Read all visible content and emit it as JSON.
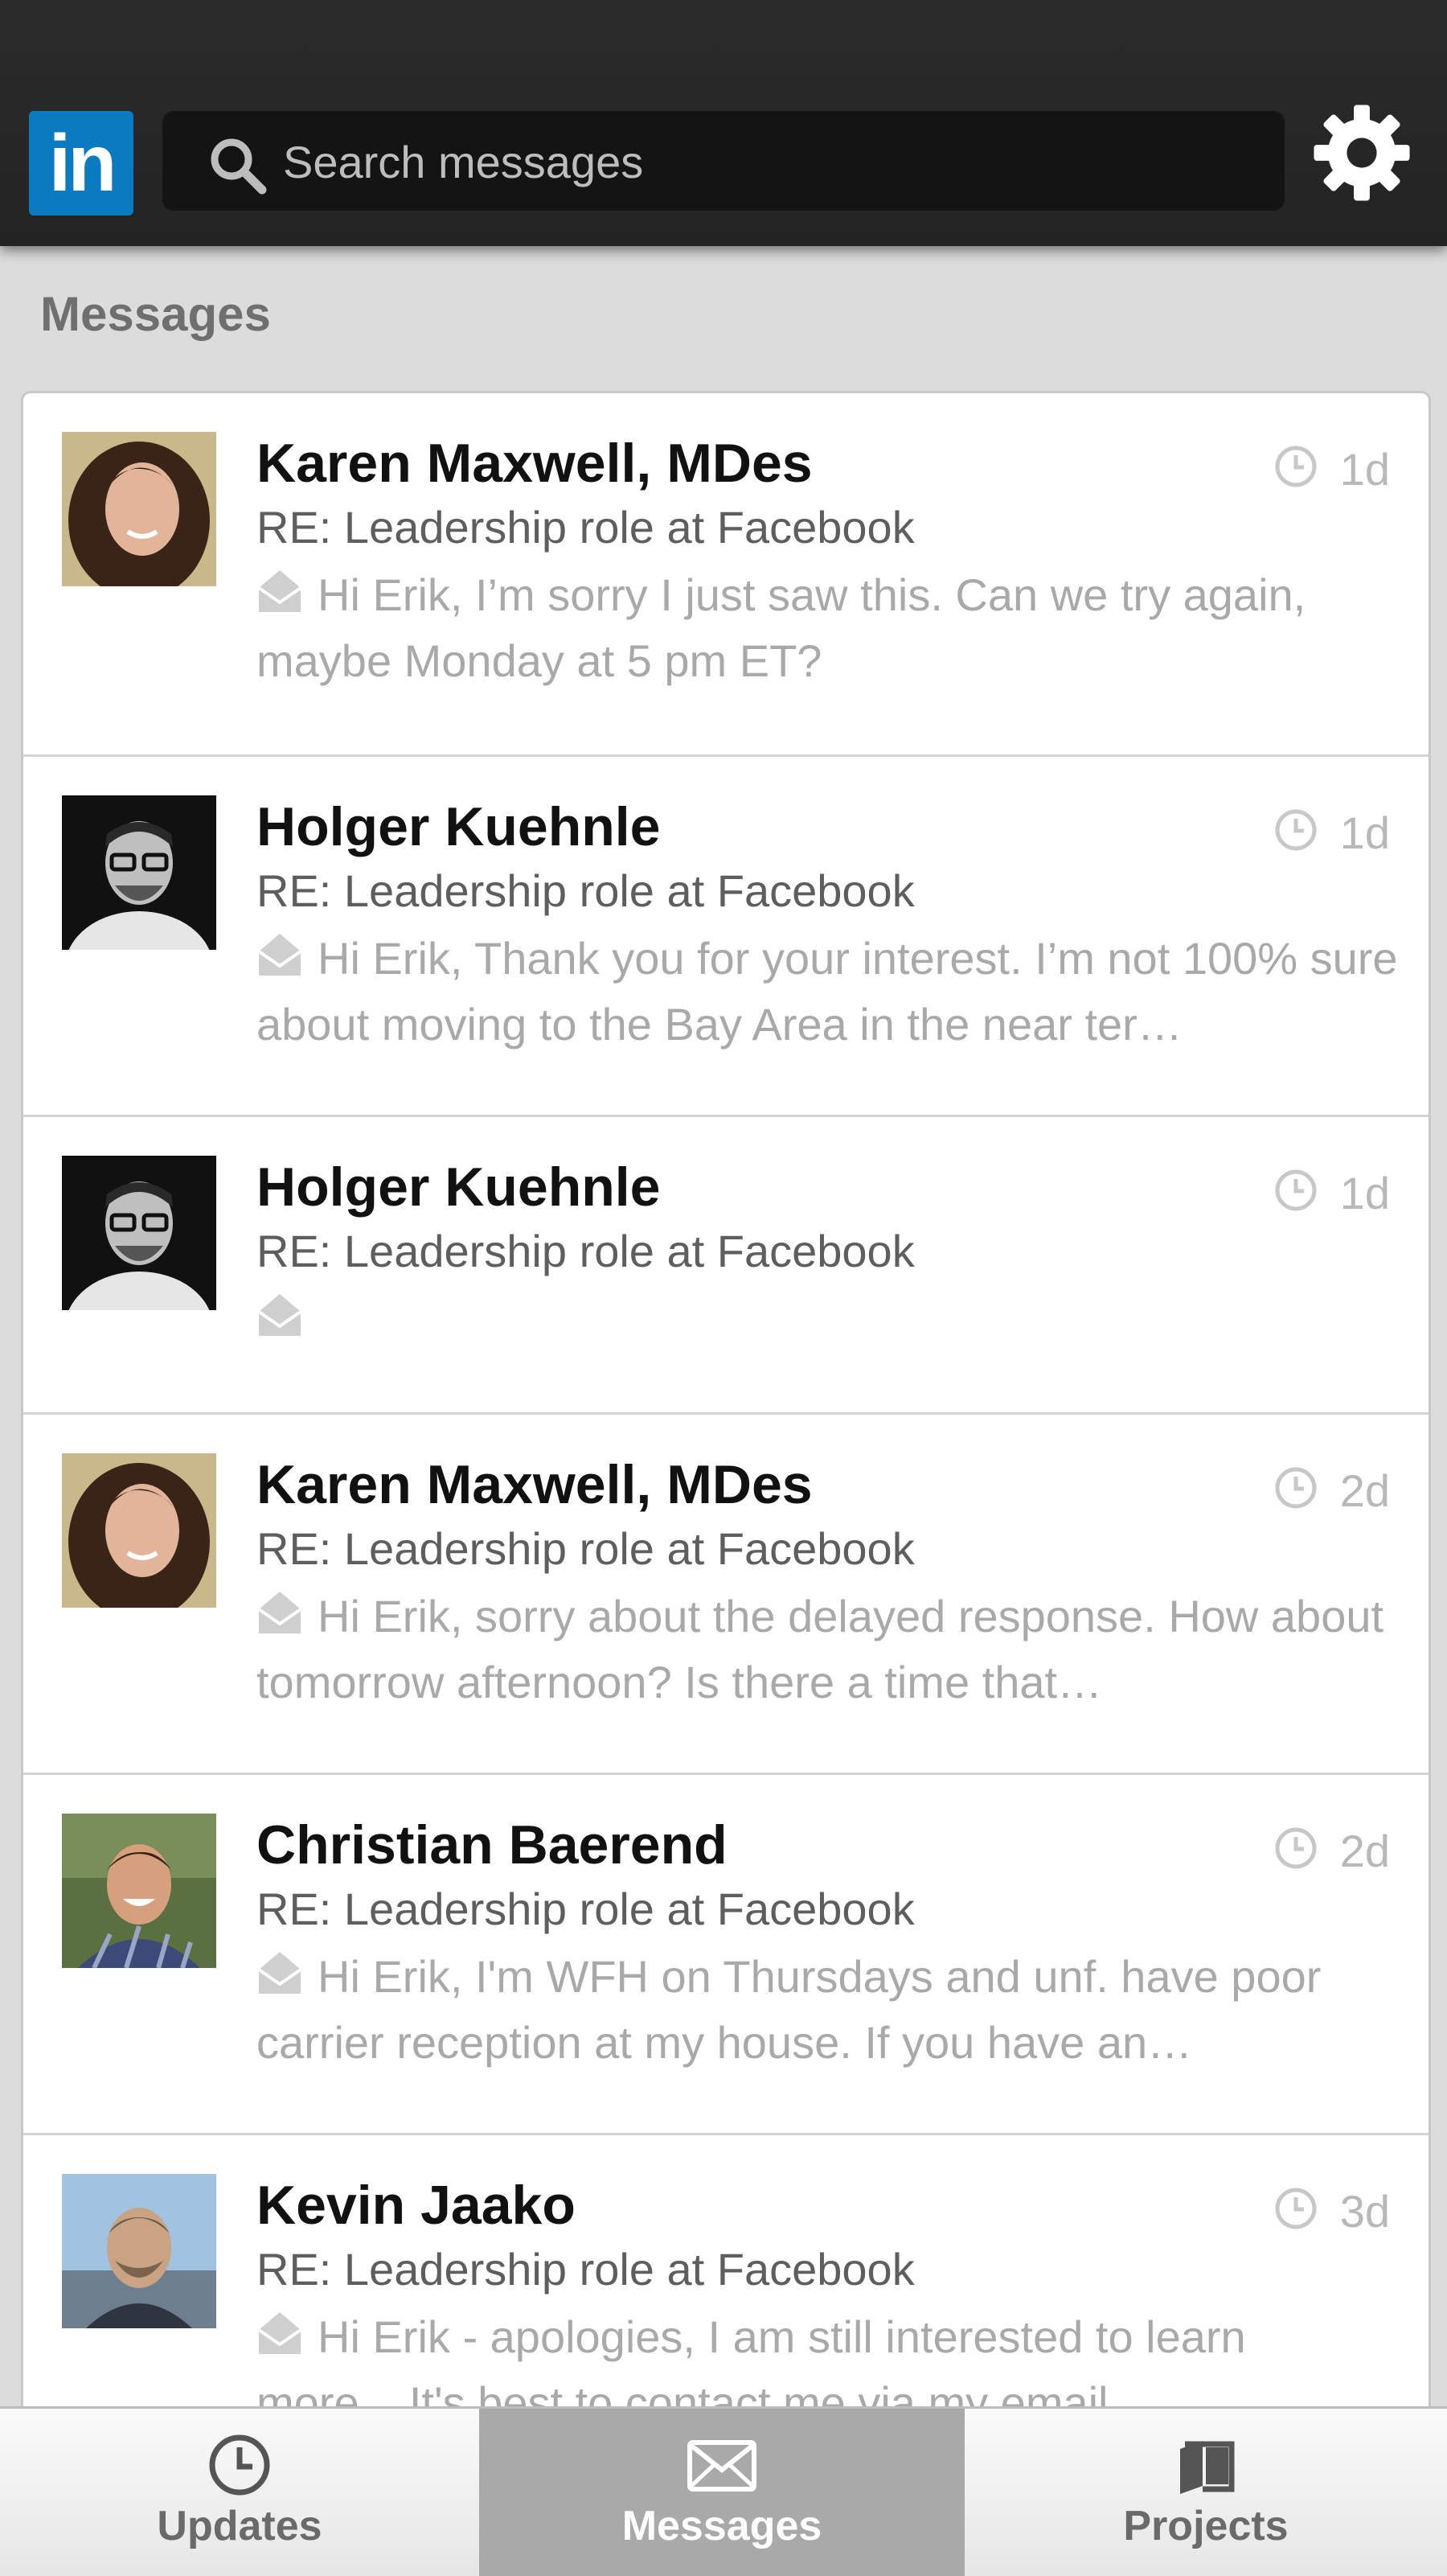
{
  "header": {
    "logo_text": "in",
    "search_placeholder": "Search messages"
  },
  "section_title": "Messages",
  "messages": [
    {
      "name": "Karen Maxwell, MDes",
      "subject": "RE: Leadership role at Facebook",
      "age": "1d",
      "preview": "Hi Erik, I’m sorry I just saw this. Can we try again, maybe Monday at 5 pm ET?"
    },
    {
      "name": "Holger Kuehnle",
      "subject": "RE: Leadership role at Facebook",
      "age": "1d",
      "preview": "Hi Erik, Thank you for your interest. I’m not 100% sure about moving to the Bay Area in the near ter…"
    },
    {
      "name": "Holger Kuehnle",
      "subject": "RE: Leadership role at Facebook",
      "age": "1d",
      "preview": ""
    },
    {
      "name": "Karen Maxwell, MDes",
      "subject": "RE: Leadership role at Facebook",
      "age": "2d",
      "preview": "Hi Erik, sorry about the delayed response. How about tomorrow afternoon? Is there a time that…"
    },
    {
      "name": "Christian Baerend",
      "subject": "RE: Leadership role at Facebook",
      "age": "2d",
      "preview": "Hi Erik, I'm WFH on Thursdays and unf. have poor carrier reception at my house. If you have an…"
    },
    {
      "name": "Kevin Jaako",
      "subject": "RE: Leadership role at Facebook",
      "age": "3d",
      "preview": "Hi Erik - apologies, I am still interested to learn more... It's best to contact me via my email..."
    }
  ],
  "tabs": [
    {
      "label": "Updates",
      "icon": "clock-icon",
      "active": false
    },
    {
      "label": "Messages",
      "icon": "envelope-icon",
      "active": true
    },
    {
      "label": "Projects",
      "icon": "folder-icon",
      "active": false
    }
  ],
  "colors": {
    "brand": "#0a7bc1",
    "topbar": "#262626",
    "active_tab": "#a9a9a9"
  }
}
